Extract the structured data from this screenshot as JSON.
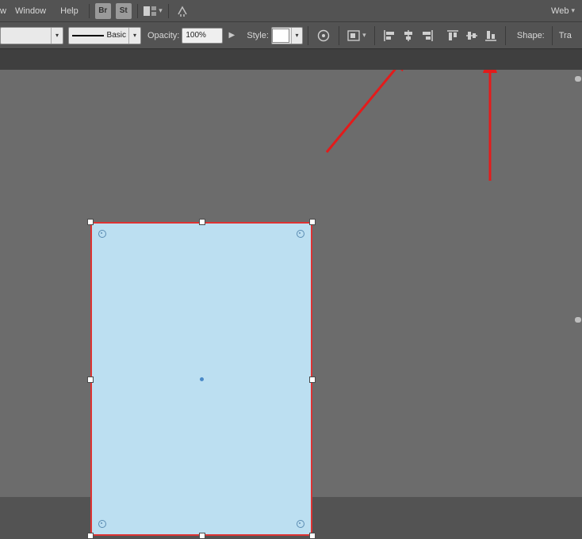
{
  "menubar": {
    "truncated_first": "w",
    "items": [
      "Window",
      "Help"
    ],
    "bridge_label": "Br",
    "stock_label": "St",
    "workspace_label": "Web"
  },
  "toolbar": {
    "stroke_label": "Basic",
    "opacity_label": "Opacity:",
    "opacity_value": "100%",
    "style_label": "Style:",
    "shape_label": "Shape:",
    "transform_truncated": "Tra"
  },
  "align": {
    "left": "align-left",
    "hcenter": "align-horizontal-center",
    "right": "align-right",
    "top": "align-top",
    "vcenter": "align-vertical-center",
    "bottom": "align-bottom"
  },
  "annotations": {
    "arrow1_target": "align-horizontal-center",
    "arrow2_target": "align-vertical-center"
  },
  "colors": {
    "shape_fill": "#bcdff1",
    "selection_stroke": "#d33",
    "arrow": "#e31b1b"
  }
}
